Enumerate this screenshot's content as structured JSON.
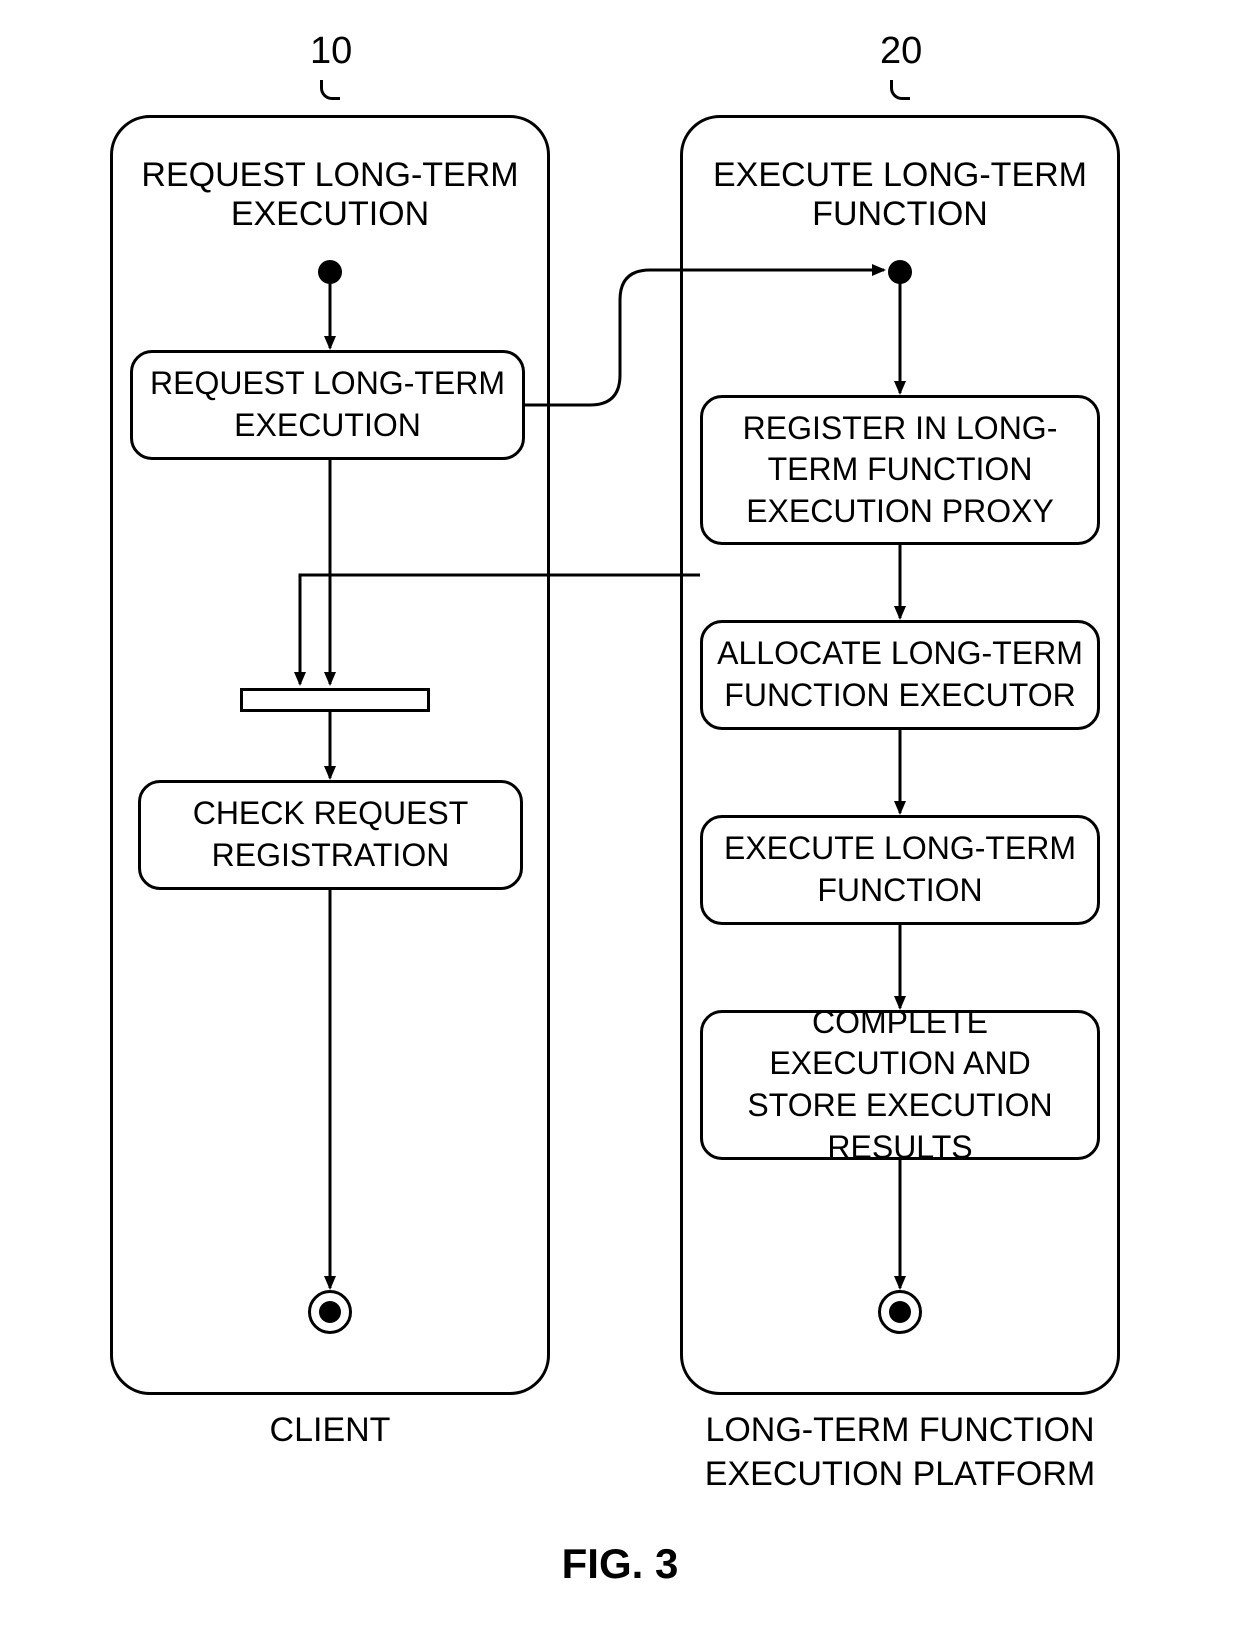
{
  "refs": {
    "left": "10",
    "right": "20"
  },
  "client": {
    "lane_title": "REQUEST LONG-TERM EXECUTION",
    "step_request": "REQUEST LONG-TERM EXECUTION",
    "step_check": "CHECK REQUEST REGISTRATION",
    "footer": "CLIENT"
  },
  "platform": {
    "lane_title": "EXECUTE LONG-TERM FUNCTION",
    "step_register": "REGISTER IN LONG-TERM FUNCTION EXECUTION PROXY",
    "step_allocate": "ALLOCATE LONG-TERM FUNCTION EXECUTOR",
    "step_execute": "EXECUTE LONG-TERM FUNCTION",
    "step_complete": "COMPLETE EXECUTION AND STORE EXECUTION RESULTS",
    "footer_line1": "LONG-TERM FUNCTION",
    "footer_line2": "EXECUTION PLATFORM"
  },
  "figure": "FIG. 3"
}
